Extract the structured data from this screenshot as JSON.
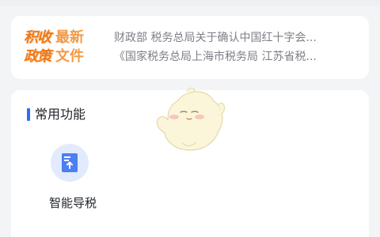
{
  "policy": {
    "brand_line1": {
      "strong": "积收",
      "light": "最新"
    },
    "brand_line2": {
      "strong": "政策",
      "light": "文件"
    },
    "news": [
      "财政部 税务总局关于确认中国红十字会...",
      "《国家税务总局上海市税务局 江苏省税..."
    ]
  },
  "functions": {
    "title": "常用功能",
    "items": [
      {
        "label": "智能导税",
        "icon": "document-upload-icon"
      }
    ]
  },
  "colors": {
    "brand_orange": "#f07818",
    "accent_blue": "#2e6ef2",
    "icon_bg": "#e2ebfd"
  }
}
